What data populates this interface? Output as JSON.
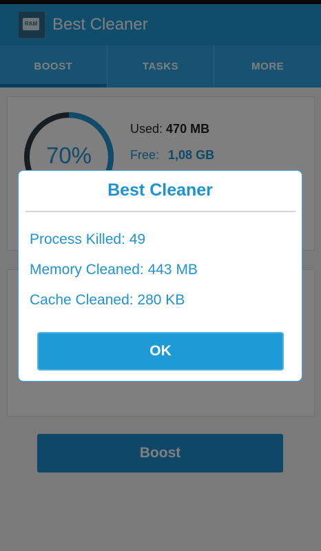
{
  "app": {
    "title": "Best Cleaner",
    "icon": "ram-chip-icon",
    "icon_text": "RAM"
  },
  "tabs": [
    {
      "label": "BOOST",
      "active": true
    },
    {
      "label": "TASKS",
      "active": false
    },
    {
      "label": "MORE",
      "active": false
    }
  ],
  "memory": {
    "percent_text": "70%",
    "percent_value": 70,
    "used_label": "Used:",
    "used_value": "470 MB",
    "free_label": "Free:",
    "free_value": "1,08 GB"
  },
  "boost_button": {
    "label": "Boost"
  },
  "dialog": {
    "title": "Best Cleaner",
    "lines": [
      "Process Killed: 49",
      "Memory Cleaned: 443 MB",
      "Cache Cleaned: 280 KB"
    ],
    "ok_label": "OK"
  },
  "colors": {
    "accent": "#1e9ad6",
    "accent_dark": "#0f7fc0",
    "text_blue": "#1f93d2"
  }
}
